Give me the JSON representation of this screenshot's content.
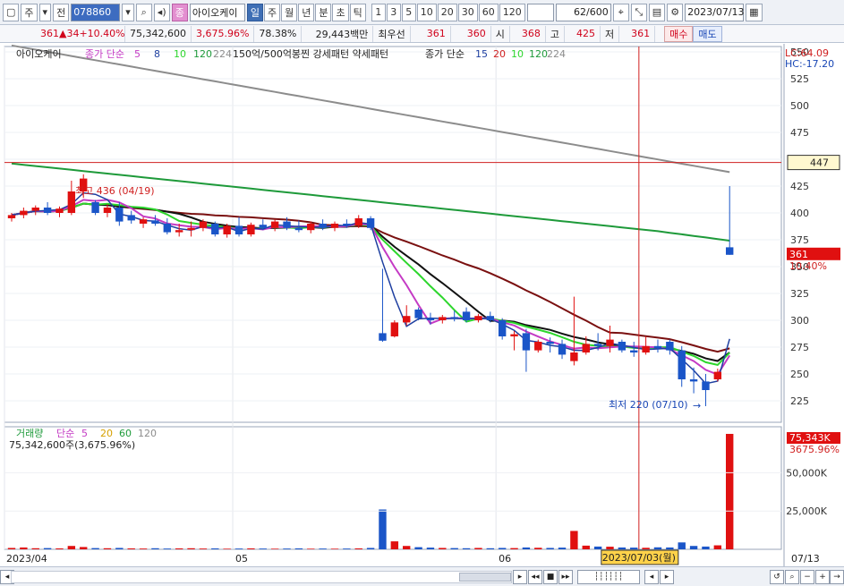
{
  "toolbar": {
    "period_select": "주",
    "market_select": "전",
    "code": "078860",
    "name": "아이오케이",
    "name_badge": "종",
    "periods": [
      "일",
      "주",
      "월",
      "년",
      "분",
      "초",
      "틱"
    ],
    "active_period": "일",
    "intervals": [
      "1",
      "3",
      "5",
      "10",
      "20",
      "30",
      "60",
      "120"
    ],
    "count": "62",
    "count_total": "/600",
    "date": "2023/07/13"
  },
  "quote": {
    "price": "361",
    "change_arrow": "▲",
    "change": "34",
    "change_pct": "+10.40%",
    "volume": "75,342,600",
    "volume_ratio": "3,675.96%",
    "turnover": "78.38%",
    "amount": "29,443백만",
    "best_ask_label": "최우선",
    "best_ask": "361",
    "best_bid": "360",
    "open_label": "시",
    "open": "368",
    "high_label": "고",
    "high": "425",
    "low_label": "저",
    "low": "361",
    "buy_label": "매수",
    "sell_label": "매도"
  },
  "price_panel": {
    "legend_name": "아이오케이",
    "legend_ma": "종가 단순",
    "legend_ma_periods": [
      "5",
      "8",
      "10",
      "120",
      "224"
    ],
    "legend_extra": "150억/500억봉찐 강세패턴  약세패턴",
    "legend_ma2": "종가 단순",
    "legend_ma2_periods": [
      "15",
      "20",
      "10",
      "120",
      "224"
    ],
    "lc": "LC:64.09",
    "hc": "HC:-17.20",
    "high_note": "최고 436 (04/19)",
    "low_note": "최저 220 (07/10)",
    "cursor_price": "447",
    "last_price": "361",
    "last_pct": "10.40%"
  },
  "volume_panel": {
    "legend_name": "거래량",
    "legend_ma": "단순",
    "legend_ma_periods": [
      "5",
      "20",
      "60",
      "120"
    ],
    "value_text": "75,342,600주(3,675.96%)",
    "last_label": "75,343K",
    "last_pct": "3675.96%"
  },
  "x_axis": {
    "labels": [
      "2023/04",
      "05",
      "06",
      "07/13"
    ],
    "cursor_date": "2023/07/03(월)"
  },
  "chart_data": {
    "type": "candlestick",
    "y_ticks": [
      225,
      250,
      275,
      300,
      325,
      350,
      375,
      400,
      425,
      450,
      475,
      500,
      525,
      550
    ],
    "ylim": [
      205,
      555
    ],
    "volume_ticks": [
      "25,000K",
      "50,000K"
    ],
    "volume_ylim": [
      0,
      80000
    ],
    "candles": [
      {
        "o": 395,
        "h": 400,
        "l": 392,
        "c": 398
      },
      {
        "o": 398,
        "h": 405,
        "l": 395,
        "c": 402
      },
      {
        "o": 402,
        "h": 407,
        "l": 398,
        "c": 405
      },
      {
        "o": 405,
        "h": 410,
        "l": 398,
        "c": 400
      },
      {
        "o": 400,
        "h": 406,
        "l": 396,
        "c": 404
      },
      {
        "o": 400,
        "h": 430,
        "l": 398,
        "c": 420
      },
      {
        "o": 420,
        "h": 436,
        "l": 414,
        "c": 432
      },
      {
        "o": 410,
        "h": 412,
        "l": 398,
        "c": 400
      },
      {
        "o": 400,
        "h": 408,
        "l": 396,
        "c": 405
      },
      {
        "o": 405,
        "h": 410,
        "l": 388,
        "c": 392
      },
      {
        "o": 398,
        "h": 402,
        "l": 390,
        "c": 393
      },
      {
        "o": 390,
        "h": 396,
        "l": 386,
        "c": 394
      },
      {
        "o": 393,
        "h": 398,
        "l": 388,
        "c": 390
      },
      {
        "o": 390,
        "h": 395,
        "l": 380,
        "c": 382
      },
      {
        "o": 382,
        "h": 390,
        "l": 378,
        "c": 384
      },
      {
        "o": 384,
        "h": 392,
        "l": 378,
        "c": 386
      },
      {
        "o": 386,
        "h": 394,
        "l": 383,
        "c": 392
      },
      {
        "o": 390,
        "h": 392,
        "l": 378,
        "c": 380
      },
      {
        "o": 380,
        "h": 390,
        "l": 377,
        "c": 388
      },
      {
        "o": 388,
        "h": 396,
        "l": 378,
        "c": 380
      },
      {
        "o": 380,
        "h": 391,
        "l": 378,
        "c": 389
      },
      {
        "o": 389,
        "h": 394,
        "l": 384,
        "c": 386
      },
      {
        "o": 386,
        "h": 394,
        "l": 383,
        "c": 392
      },
      {
        "o": 392,
        "h": 396,
        "l": 384,
        "c": 386
      },
      {
        "o": 386,
        "h": 393,
        "l": 382,
        "c": 384
      },
      {
        "o": 384,
        "h": 392,
        "l": 381,
        "c": 390
      },
      {
        "o": 390,
        "h": 394,
        "l": 384,
        "c": 386
      },
      {
        "o": 386,
        "h": 392,
        "l": 383,
        "c": 390
      },
      {
        "o": 390,
        "h": 394,
        "l": 386,
        "c": 388
      },
      {
        "o": 388,
        "h": 398,
        "l": 386,
        "c": 395
      },
      {
        "o": 395,
        "h": 397,
        "l": 384,
        "c": 386
      },
      {
        "o": 288,
        "h": 348,
        "l": 280,
        "c": 281
      },
      {
        "o": 285,
        "h": 300,
        "l": 284,
        "c": 298
      },
      {
        "o": 298,
        "h": 314,
        "l": 295,
        "c": 304
      },
      {
        "o": 310,
        "h": 312,
        "l": 300,
        "c": 302
      },
      {
        "o": 302,
        "h": 307,
        "l": 296,
        "c": 300
      },
      {
        "o": 300,
        "h": 305,
        "l": 297,
        "c": 303
      },
      {
        "o": 303,
        "h": 309,
        "l": 299,
        "c": 302
      },
      {
        "o": 308,
        "h": 312,
        "l": 298,
        "c": 300
      },
      {
        "o": 300,
        "h": 306,
        "l": 298,
        "c": 304
      },
      {
        "o": 304,
        "h": 308,
        "l": 298,
        "c": 300
      },
      {
        "o": 300,
        "h": 302,
        "l": 282,
        "c": 285
      },
      {
        "o": 285,
        "h": 290,
        "l": 272,
        "c": 287
      },
      {
        "o": 288,
        "h": 292,
        "l": 252,
        "c": 272
      },
      {
        "o": 272,
        "h": 282,
        "l": 270,
        "c": 280
      },
      {
        "o": 280,
        "h": 284,
        "l": 270,
        "c": 278
      },
      {
        "o": 278,
        "h": 282,
        "l": 264,
        "c": 268
      },
      {
        "o": 262,
        "h": 322,
        "l": 258,
        "c": 270
      },
      {
        "o": 270,
        "h": 285,
        "l": 268,
        "c": 278
      },
      {
        "o": 278,
        "h": 288,
        "l": 272,
        "c": 276
      },
      {
        "o": 276,
        "h": 295,
        "l": 270,
        "c": 282
      },
      {
        "o": 280,
        "h": 282,
        "l": 270,
        "c": 272
      },
      {
        "o": 272,
        "h": 280,
        "l": 266,
        "c": 270
      },
      {
        "o": 270,
        "h": 285,
        "l": 268,
        "c": 276
      },
      {
        "o": 276,
        "h": 282,
        "l": 270,
        "c": 274
      },
      {
        "o": 280,
        "h": 282,
        "l": 268,
        "c": 272
      },
      {
        "o": 272,
        "h": 276,
        "l": 238,
        "c": 245
      },
      {
        "o": 245,
        "h": 256,
        "l": 232,
        "c": 243
      },
      {
        "o": 243,
        "h": 250,
        "l": 220,
        "c": 235
      },
      {
        "o": 245,
        "h": 255,
        "l": 243,
        "c": 252
      },
      {
        "o": 368,
        "h": 425,
        "l": 361,
        "c": 361
      }
    ],
    "volume": [
      900,
      1200,
      700,
      800,
      600,
      2200,
      1500,
      800,
      700,
      900,
      600,
      500,
      700,
      500,
      600,
      700,
      500,
      600,
      400,
      500,
      600,
      500,
      400,
      500,
      600,
      400,
      500,
      400,
      500,
      600,
      900,
      26000,
      5200,
      2200,
      1400,
      1100,
      900,
      800,
      700,
      900,
      700,
      900,
      800,
      1200,
      1000,
      900,
      1100,
      12000,
      2400,
      1800,
      1700,
      1200,
      1100,
      1000,
      1300,
      1200,
      4500,
      2200,
      1800,
      2600,
      75343
    ]
  }
}
